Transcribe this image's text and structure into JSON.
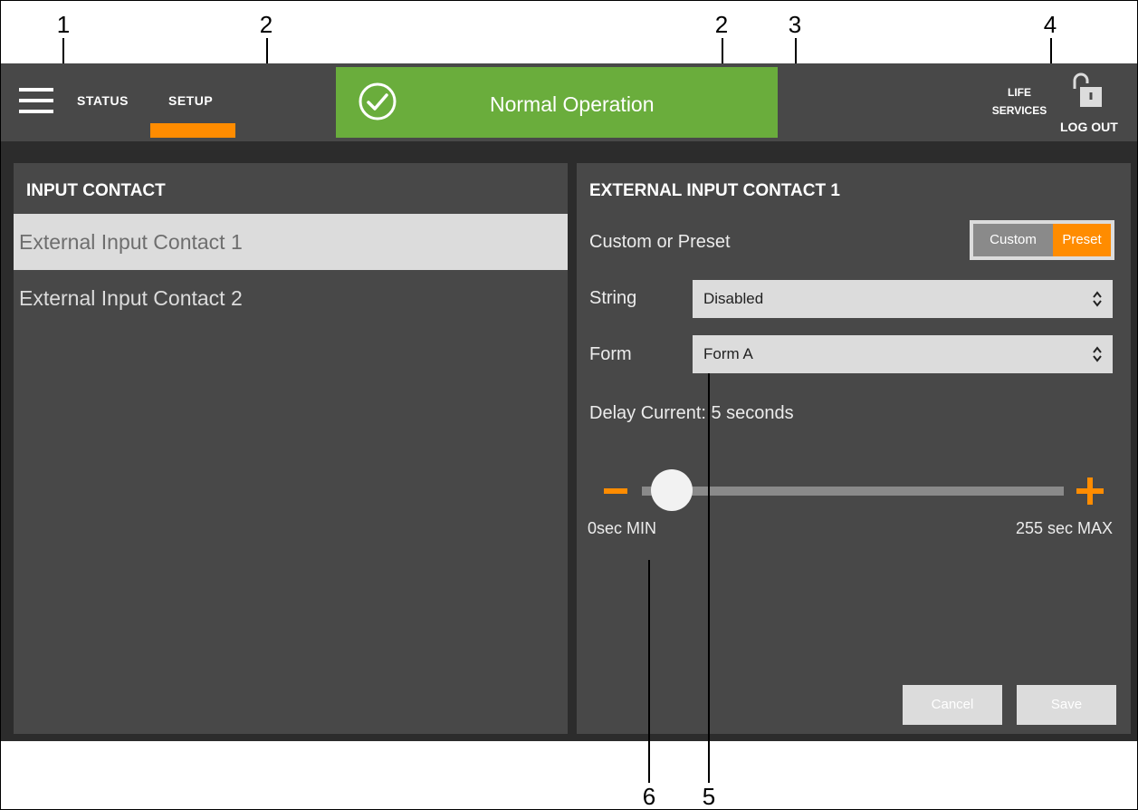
{
  "callouts": [
    "1",
    "2",
    "2",
    "3",
    "4",
    "5",
    "6"
  ],
  "header": {
    "tabs": [
      {
        "label": "STATUS"
      },
      {
        "label": "SETUP"
      }
    ],
    "status_text": "Normal Operation",
    "life_services": "LIFE SERVICES",
    "logout": "LOG OUT"
  },
  "left_panel": {
    "title": "INPUT CONTACT",
    "items": [
      {
        "label": "External Input Contact 1",
        "selected": true
      },
      {
        "label": "External Input Contact 2",
        "selected": false
      }
    ]
  },
  "right_panel": {
    "title": "EXTERNAL INPUT CONTACT 1",
    "mode_label": "Custom or Preset",
    "mode_options": [
      "Custom",
      "Preset"
    ],
    "mode_selected": "Preset",
    "string_label": "String",
    "string_value": "Disabled",
    "form_label": "Form",
    "form_value": "Form A",
    "delay_text": "Delay Current: 5 seconds",
    "slider_min_label": "0sec MIN",
    "slider_max_label": "255 sec MAX",
    "slider_min": 0,
    "slider_max": 255,
    "slider_value": 5,
    "cancel_label": "Cancel",
    "save_label": "Save"
  },
  "colors": {
    "accent": "#ff8c00",
    "status_ok": "#6aad3c",
    "panel": "#484848",
    "background": "#2c2c2c"
  },
  "icons": {
    "menu": "hamburger-icon",
    "status": "check-circle-icon",
    "lock": "unlocked-padlock-icon",
    "select_arrow": "chevron-up-down-icon"
  }
}
